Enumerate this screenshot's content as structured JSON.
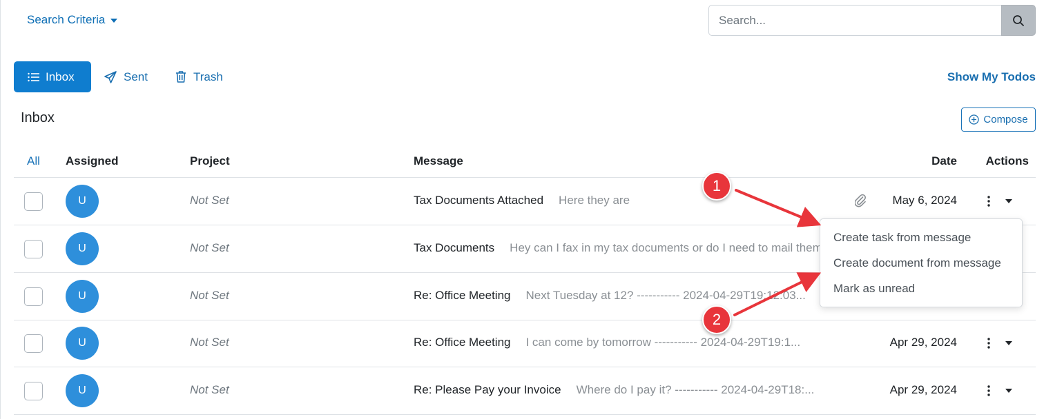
{
  "search_criteria": {
    "label": "Search Criteria"
  },
  "search": {
    "placeholder": "Search..."
  },
  "tabs": [
    {
      "label": "Inbox",
      "active": true
    },
    {
      "label": "Sent"
    },
    {
      "label": "Trash"
    }
  ],
  "show_todos": "Show My Todos",
  "section_title": "Inbox",
  "compose": "Compose",
  "table": {
    "headers": {
      "all": "All",
      "assigned": "Assigned",
      "project": "Project",
      "message": "Message",
      "date": "Date",
      "actions": "Actions"
    },
    "rows": [
      {
        "avatar": "U",
        "project": "Not Set",
        "subject": "Tax Documents Attached",
        "preview": "Here they are",
        "attachment": true,
        "date": "May 6, 2024"
      },
      {
        "avatar": "U",
        "project": "Not Set",
        "subject": "Tax Documents",
        "preview": "Hey can I fax in my tax documents or do I need to mail them?",
        "date": ""
      },
      {
        "avatar": "U",
        "project": "Not Set",
        "subject": "Re: Office Meeting",
        "preview": "Next Tuesday at 12? ----------- 2024-04-29T19:12:03...",
        "date": ""
      },
      {
        "avatar": "U",
        "project": "Not Set",
        "subject": "Re: Office Meeting",
        "preview": "I can come by tomorrow ----------- 2024-04-29T19:1...",
        "date": "Apr 29, 2024"
      },
      {
        "avatar": "U",
        "project": "Not Set",
        "subject": "Re: Please Pay your Invoice",
        "preview": "Where do I pay it? ----------- 2024-04-29T18:...",
        "date": "Apr 29, 2024"
      }
    ]
  },
  "action_menu": {
    "items": [
      {
        "label": "Create task from message"
      },
      {
        "label": "Create document from message"
      },
      {
        "label": "Mark as unread"
      }
    ]
  },
  "callouts": [
    {
      "number": "1"
    },
    {
      "number": "2"
    }
  ],
  "colors": {
    "primary": "#0f7dcf",
    "link": "#1a6fb0",
    "avatar": "#2e8fdb",
    "callout": "#e8353b"
  }
}
